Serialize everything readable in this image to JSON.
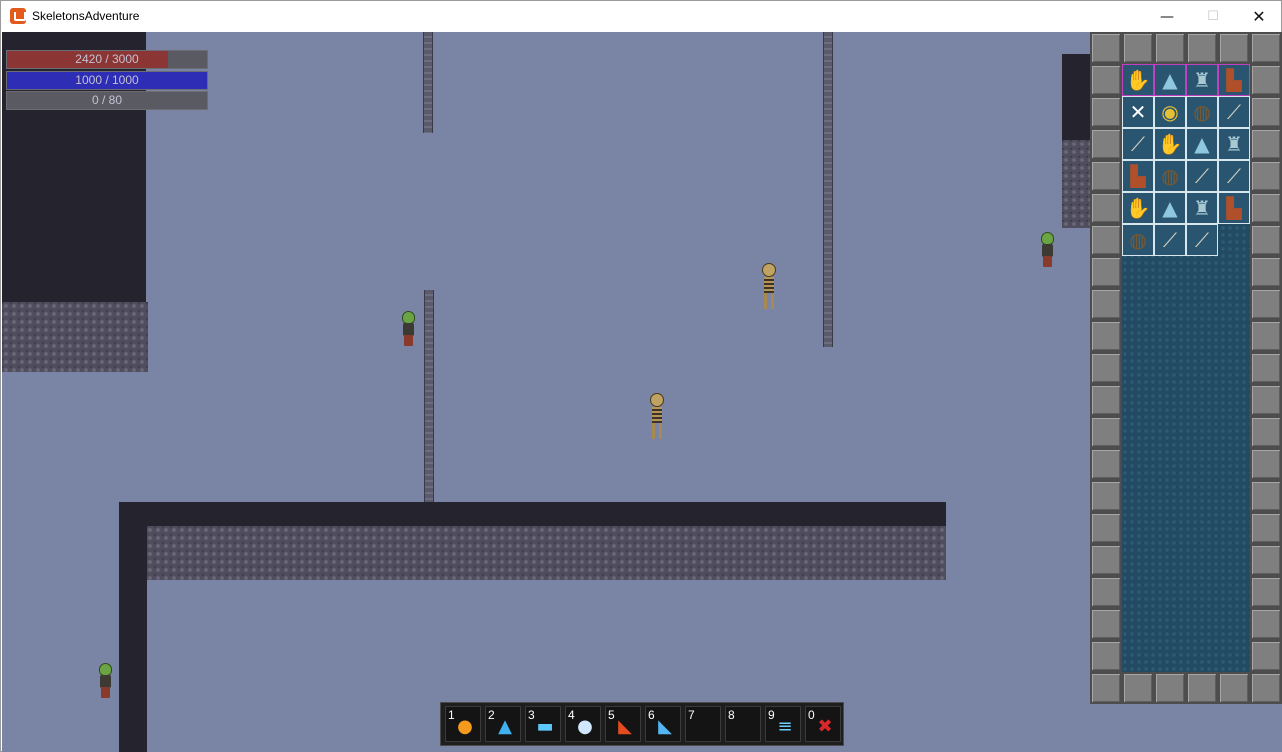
{
  "window": {
    "title": "SkeletonsAdventure",
    "minimize_glyph": "—",
    "maximize_glyph": "☐",
    "close_glyph": "✕"
  },
  "hud": {
    "health": {
      "text": "2420 / 3000",
      "current": 2420,
      "max": 3000,
      "color": "#8b3535"
    },
    "mana": {
      "text": "1000 / 1000",
      "current": 1000,
      "max": 1000,
      "color": "#2d2db5"
    },
    "experience": {
      "text": "0 / 80",
      "current": 0,
      "max": 80,
      "color": "#5a5a62"
    }
  },
  "inventory": {
    "equipped": [
      {
        "icon": "gloves-icon",
        "glyph": "✋",
        "cls": "item-gloves"
      },
      {
        "icon": "wizard-hat-icon",
        "glyph": "▲",
        "cls": "item-hat"
      },
      {
        "icon": "armor-icon",
        "glyph": "♜",
        "cls": "item-armor"
      },
      {
        "icon": "boots-icon",
        "glyph": "▙",
        "cls": "item-boots"
      }
    ],
    "items": [
      {
        "icon": "crossed-bones-icon",
        "glyph": "✕",
        "cls": "item-bones"
      },
      {
        "icon": "gold-coins-icon",
        "glyph": "◉",
        "cls": "item-coins"
      },
      {
        "icon": "round-shield-icon",
        "glyph": "◍",
        "cls": "item-shield"
      },
      {
        "icon": "sword-icon",
        "glyph": "⟋",
        "cls": "item-sword"
      },
      {
        "icon": "sword-icon",
        "glyph": "⟋",
        "cls": "item-sword"
      },
      {
        "icon": "gloves-icon",
        "glyph": "✋",
        "cls": "item-gloves"
      },
      {
        "icon": "wizard-hat-icon",
        "glyph": "▲",
        "cls": "item-hat"
      },
      {
        "icon": "armor-icon",
        "glyph": "♜",
        "cls": "item-armor"
      },
      {
        "icon": "boots-icon",
        "glyph": "▙",
        "cls": "item-boots"
      },
      {
        "icon": "round-shield-icon",
        "glyph": "◍",
        "cls": "item-shield"
      },
      {
        "icon": "sword-icon",
        "glyph": "⟋",
        "cls": "item-sword"
      },
      {
        "icon": "sword-icon",
        "glyph": "⟋",
        "cls": "item-sword"
      },
      {
        "icon": "gloves-icon",
        "glyph": "✋",
        "cls": "item-gloves"
      },
      {
        "icon": "wizard-hat-icon",
        "glyph": "▲",
        "cls": "item-hat"
      },
      {
        "icon": "armor-icon",
        "glyph": "♜",
        "cls": "item-armor"
      },
      {
        "icon": "boots-icon",
        "glyph": "▙",
        "cls": "item-boots"
      },
      {
        "icon": "round-shield-icon",
        "glyph": "◍",
        "cls": "item-shield"
      },
      {
        "icon": "sword-icon",
        "glyph": "⟋",
        "cls": "item-sword"
      },
      {
        "icon": "sword-icon",
        "glyph": "⟋",
        "cls": "item-sword"
      }
    ]
  },
  "hotbar": [
    {
      "key": "1",
      "icon": "fireball-icon",
      "glyph": "●",
      "cls": "sk-fire"
    },
    {
      "key": "2",
      "icon": "water-spout-icon",
      "glyph": "▲",
      "cls": "sk-water"
    },
    {
      "key": "3",
      "icon": "ice-bolt-icon",
      "glyph": "▬",
      "cls": "sk-dash"
    },
    {
      "key": "4",
      "icon": "frost-orb-icon",
      "glyph": "●",
      "cls": "sk-orb"
    },
    {
      "key": "5",
      "icon": "flame-wave-icon",
      "glyph": "◣",
      "cls": "sk-flame"
    },
    {
      "key": "6",
      "icon": "water-wave-icon",
      "glyph": "◣",
      "cls": "sk-wave"
    },
    {
      "key": "7",
      "icon": "",
      "glyph": "",
      "cls": ""
    },
    {
      "key": "8",
      "icon": "",
      "glyph": "",
      "cls": ""
    },
    {
      "key": "9",
      "icon": "dash-icon",
      "glyph": "≡",
      "cls": "sk-dash2"
    },
    {
      "key": "0",
      "icon": "blade-burst-icon",
      "glyph": "✖",
      "cls": "sk-burst"
    }
  ]
}
